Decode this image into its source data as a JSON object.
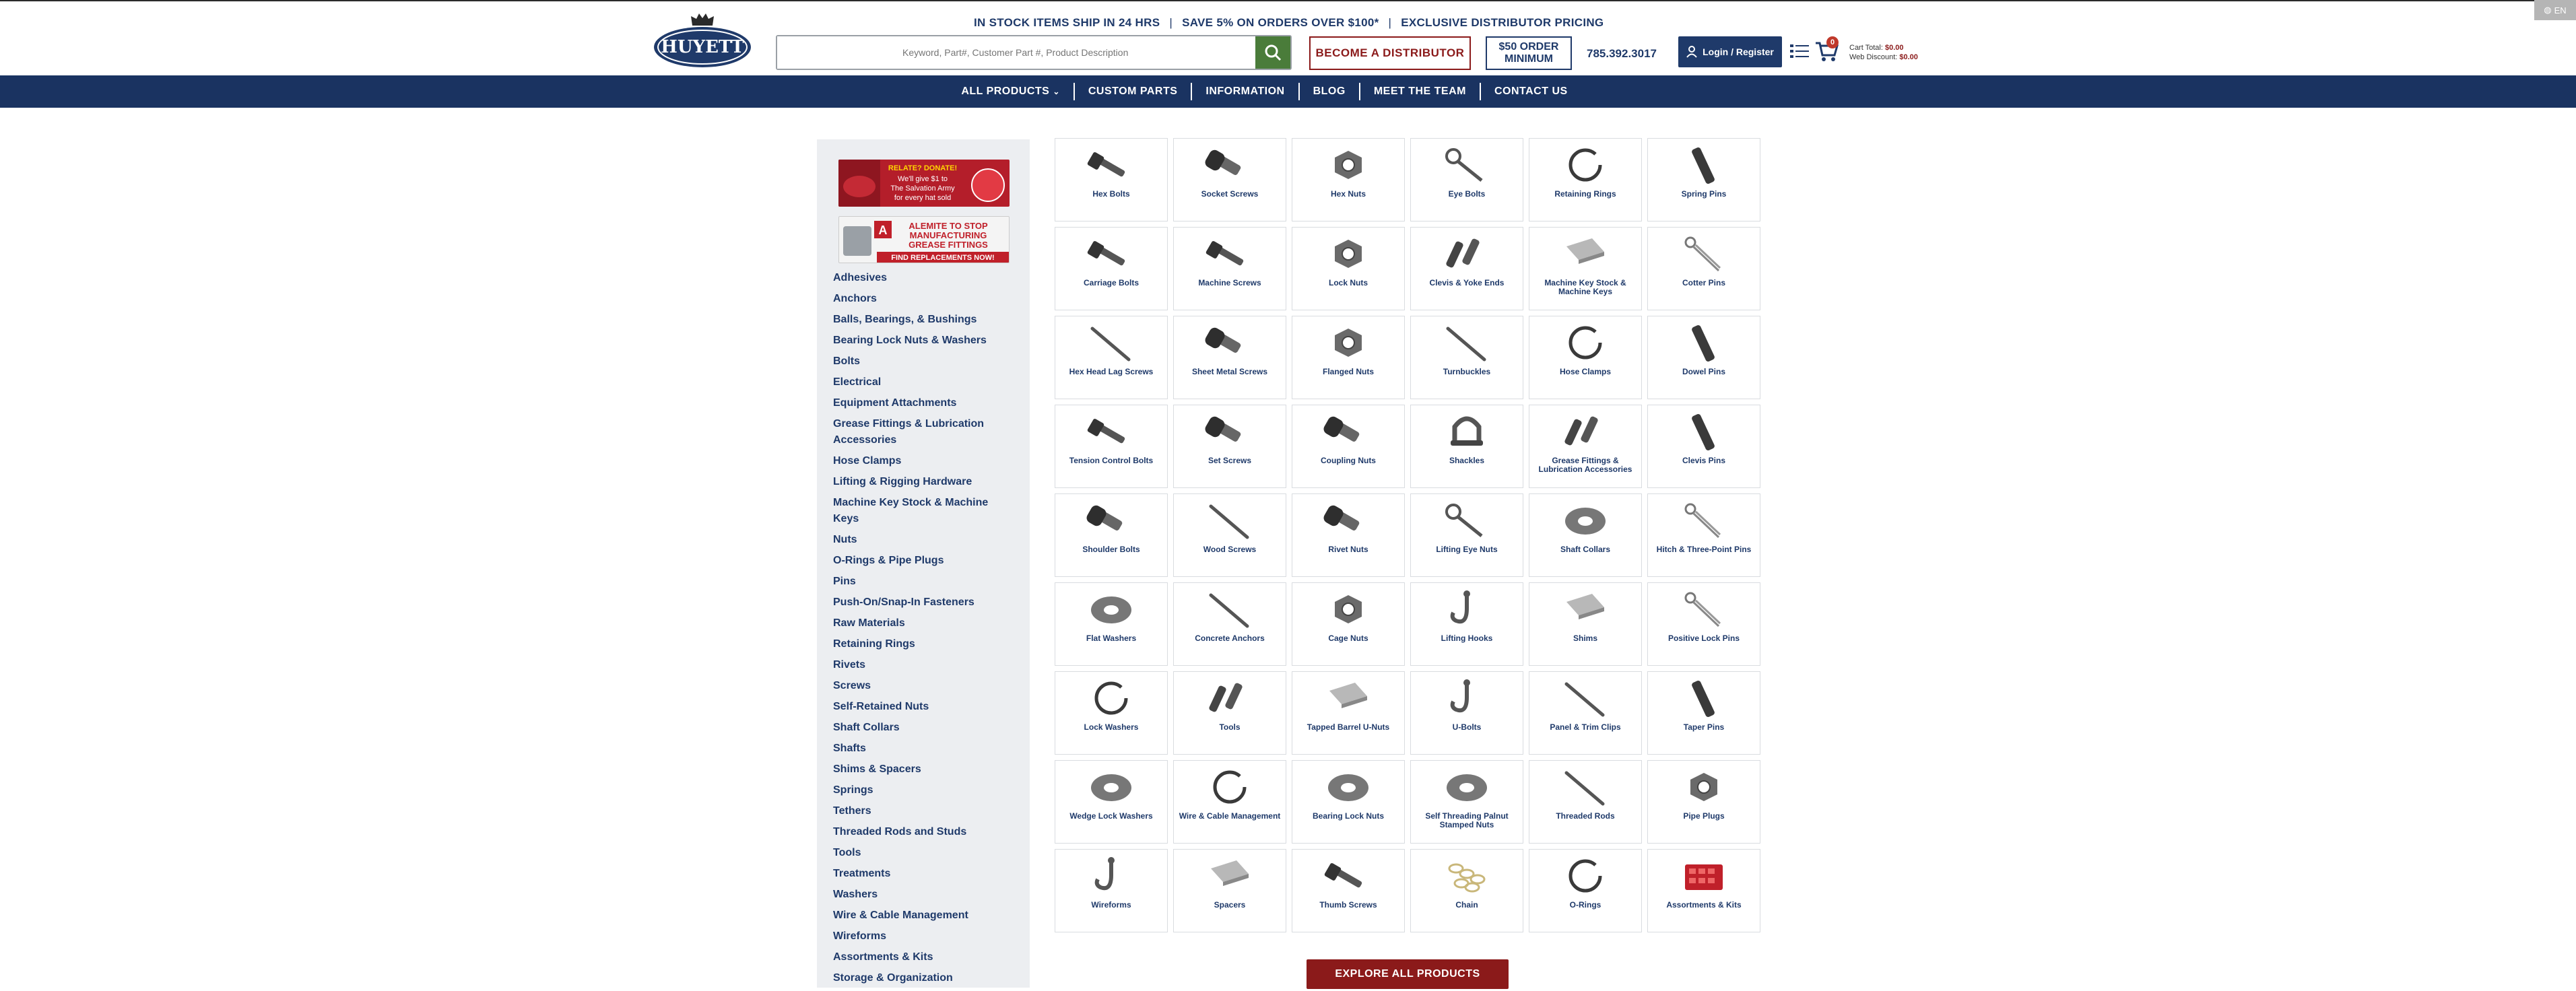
{
  "lang": {
    "label": "EN"
  },
  "header": {
    "logo_text": "HUYETT",
    "promo": [
      "IN STOCK ITEMS SHIP IN 24 HRS",
      "SAVE 5% ON ORDERS OVER $100*",
      "EXCLUSIVE DISTRIBUTOR PRICING"
    ],
    "search_placeholder": "Keyword, Part#, Customer Part #, Product Description",
    "distributor_label": "BECOME A DISTRIBUTOR",
    "minimum_line1": "$50 ORDER",
    "minimum_line2": "MINIMUM",
    "phone": "785.392.3017",
    "login_label": "Login / Register",
    "cart_count": "0",
    "cart_total_label": "Cart Total:",
    "cart_total_value": "$0.00",
    "web_discount_label": "Web Discount:",
    "web_discount_value": "$0.00"
  },
  "nav": [
    "ALL PRODUCTS",
    "CUSTOM PARTS",
    "INFORMATION",
    "BLOG",
    "MEET THE TEAM",
    "CONTACT US"
  ],
  "sidebar": {
    "ad1_text": [
      "RELATE? DONATE!",
      "We'll give $1 to",
      "The Salvation Army",
      "for every hat sold"
    ],
    "ad2_text": [
      "ALEMITE TO STOP",
      "MANUFACTURING",
      "GREASE FITTINGS",
      "FIND REPLACEMENTS NOW!"
    ],
    "categories": [
      "Adhesives",
      "Anchors",
      "Balls, Bearings, & Bushings",
      "Bearing Lock Nuts & Washers",
      "Bolts",
      "Electrical",
      "Equipment Attachments",
      "Grease Fittings & Lubrication Accessories",
      "Hose Clamps",
      "Lifting & Rigging Hardware",
      "Machine Key Stock & Machine Keys",
      "Nuts",
      "O-Rings & Pipe Plugs",
      "Pins",
      "Push-On/Snap-In Fasteners",
      "Raw Materials",
      "Retaining Rings",
      "Rivets",
      "Screws",
      "Self-Retained Nuts",
      "Shaft Collars",
      "Shafts",
      "Shims & Spacers",
      "Springs",
      "Tethers",
      "Threaded Rods and Studs",
      "Tools",
      "Treatments",
      "Washers",
      "Wire & Cable Management",
      "Wireforms",
      "Assortments & Kits",
      "Storage & Organization"
    ]
  },
  "products": [
    {
      "label": "Hex Bolts",
      "icon": "bolt"
    },
    {
      "label": "Socket Screws",
      "icon": "socket"
    },
    {
      "label": "Hex Nuts",
      "icon": "hexnut"
    },
    {
      "label": "Eye Bolts",
      "icon": "eyebolt"
    },
    {
      "label": "Retaining Rings",
      "icon": "ring"
    },
    {
      "label": "Spring Pins",
      "icon": "pin"
    },
    {
      "label": "Carriage Bolts",
      "icon": "bolt"
    },
    {
      "label": "Machine Screws",
      "icon": "bolt"
    },
    {
      "label": "Lock Nuts",
      "icon": "hexnut"
    },
    {
      "label": "Clevis & Yoke Ends",
      "icon": "clevis"
    },
    {
      "label": "Machine Key Stock & Machine Keys",
      "icon": "key"
    },
    {
      "label": "Cotter Pins",
      "icon": "cotter"
    },
    {
      "label": "Hex Head Lag Screws",
      "icon": "rod"
    },
    {
      "label": "Sheet Metal Screws",
      "icon": "socket"
    },
    {
      "label": "Flanged Nuts",
      "icon": "hexnut"
    },
    {
      "label": "Turnbuckles",
      "icon": "rod"
    },
    {
      "label": "Hose Clamps",
      "icon": "ring"
    },
    {
      "label": "Dowel Pins",
      "icon": "pin"
    },
    {
      "label": "Tension Control Bolts",
      "icon": "bolt"
    },
    {
      "label": "Set Screws",
      "icon": "socket"
    },
    {
      "label": "Coupling Nuts",
      "icon": "socket"
    },
    {
      "label": "Shackles",
      "icon": "shackle"
    },
    {
      "label": "Grease Fittings & Lubrication Accessories",
      "icon": "clevis"
    },
    {
      "label": "Clevis Pins",
      "icon": "pin"
    },
    {
      "label": "Shoulder Bolts",
      "icon": "socket"
    },
    {
      "label": "Wood Screws",
      "icon": "rod"
    },
    {
      "label": "Rivet Nuts",
      "icon": "socket"
    },
    {
      "label": "Lifting Eye Nuts",
      "icon": "eyebolt"
    },
    {
      "label": "Shaft Collars",
      "icon": "washer"
    },
    {
      "label": "Hitch & Three-Point Pins",
      "icon": "cotter"
    },
    {
      "label": "Flat Washers",
      "icon": "washer"
    },
    {
      "label": "Concrete Anchors",
      "icon": "rod"
    },
    {
      "label": "Cage Nuts",
      "icon": "hexnut"
    },
    {
      "label": "Lifting Hooks",
      "icon": "hook"
    },
    {
      "label": "Shims",
      "icon": "key"
    },
    {
      "label": "Positive Lock Pins",
      "icon": "cotter"
    },
    {
      "label": "Lock Washers",
      "icon": "ring"
    },
    {
      "label": "Tools",
      "icon": "clevis"
    },
    {
      "label": "Tapped Barrel U-Nuts",
      "icon": "key"
    },
    {
      "label": "U-Bolts",
      "icon": "hook"
    },
    {
      "label": "Panel & Trim Clips",
      "icon": "rod"
    },
    {
      "label": "Taper Pins",
      "icon": "pin"
    },
    {
      "label": "Wedge Lock Washers",
      "icon": "washer"
    },
    {
      "label": "Wire & Cable Management",
      "icon": "ring"
    },
    {
      "label": "Bearing Lock Nuts",
      "icon": "washer"
    },
    {
      "label": "Self Threading Palnut Stamped Nuts",
      "icon": "washer"
    },
    {
      "label": "Threaded Rods",
      "icon": "rod"
    },
    {
      "label": "Pipe Plugs",
      "icon": "hexnut"
    },
    {
      "label": "Wireforms",
      "icon": "hook"
    },
    {
      "label": "Spacers",
      "icon": "key"
    },
    {
      "label": "Thumb Screws",
      "icon": "bolt"
    },
    {
      "label": "Chain",
      "icon": "chain"
    },
    {
      "label": "O-Rings",
      "icon": "ring"
    },
    {
      "label": "Assortments & Kits",
      "icon": "kit"
    }
  ],
  "explore_label": "EXPLORE ALL PRODUCTS",
  "colors": {
    "navy": "#1a3361",
    "maroon": "#8b1a1a",
    "green": "#4a7c3a",
    "sidebar_bg": "#eceef1"
  }
}
